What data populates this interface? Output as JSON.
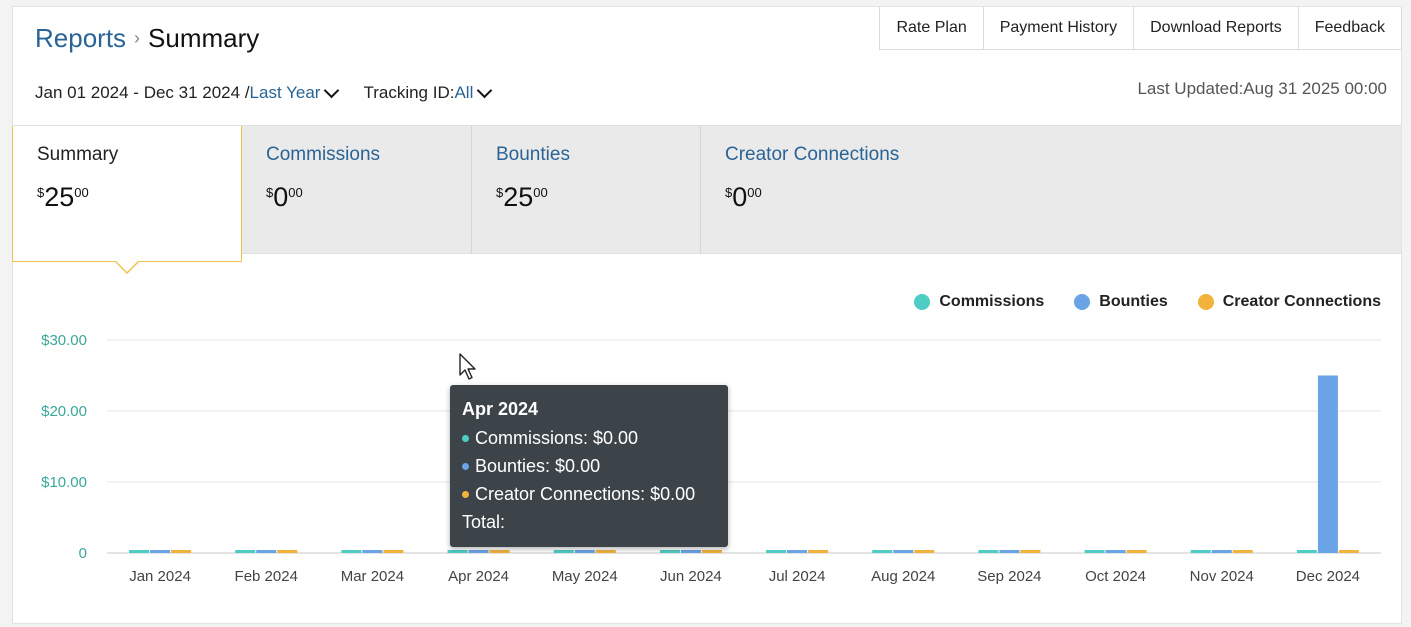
{
  "breadcrumb": {
    "parent": "Reports",
    "separator": "›",
    "current": "Summary"
  },
  "top_buttons": [
    "Rate Plan",
    "Payment History",
    "Download Reports",
    "Feedback"
  ],
  "date_range": {
    "range": "Jan 01 2024 - Dec 31 2024 /",
    "preset": "Last Year"
  },
  "tracking": {
    "label": "Tracking ID:",
    "value": "All"
  },
  "last_updated": "Last Updated:Aug 31 2025 00:00",
  "tabs": [
    {
      "label": "Summary",
      "currency": "$",
      "whole": "25",
      "fraction": "00",
      "active": true
    },
    {
      "label": "Commissions",
      "currency": "$",
      "whole": "0",
      "fraction": "00",
      "active": false
    },
    {
      "label": "Bounties",
      "currency": "$",
      "whole": "25",
      "fraction": "00",
      "active": false
    },
    {
      "label": "Creator Connections",
      "currency": "$",
      "whole": "0",
      "fraction": "00",
      "active": false
    }
  ],
  "colors": {
    "commissions": "#4ecdc4",
    "bounties": "#6aa3e6",
    "creator_connections": "#f2b33d",
    "axis_label": "#3aa79b"
  },
  "chart_data": {
    "type": "bar",
    "categories": [
      "Jan 2024",
      "Feb 2024",
      "Mar 2024",
      "Apr 2024",
      "May 2024",
      "Jun 2024",
      "Jul 2024",
      "Aug 2024",
      "Sep 2024",
      "Oct 2024",
      "Nov 2024",
      "Dec 2024"
    ],
    "series": [
      {
        "name": "Commissions",
        "values": [
          0,
          0,
          0,
          0,
          0,
          0,
          0,
          0,
          0,
          0,
          0,
          0
        ]
      },
      {
        "name": "Bounties",
        "values": [
          0,
          0,
          0,
          0,
          0,
          0,
          0,
          0,
          0,
          0,
          0,
          25
        ]
      },
      {
        "name": "Creator Connections",
        "values": [
          0,
          0,
          0,
          0,
          0,
          0,
          0,
          0,
          0,
          0,
          0,
          0
        ]
      }
    ],
    "yticks": [
      {
        "value": 0,
        "label": "0"
      },
      {
        "value": 10,
        "label": "$10.00"
      },
      {
        "value": 20,
        "label": "$20.00"
      },
      {
        "value": 30,
        "label": "$30.00"
      }
    ],
    "ylim": [
      0,
      30
    ],
    "grid": true,
    "legend": "top-right"
  },
  "tooltip": {
    "title": "Apr 2024",
    "rows": [
      "Commissions: $0.00",
      "Bounties: $0.00",
      "Creator Connections: $0.00"
    ],
    "total": "Total:"
  }
}
